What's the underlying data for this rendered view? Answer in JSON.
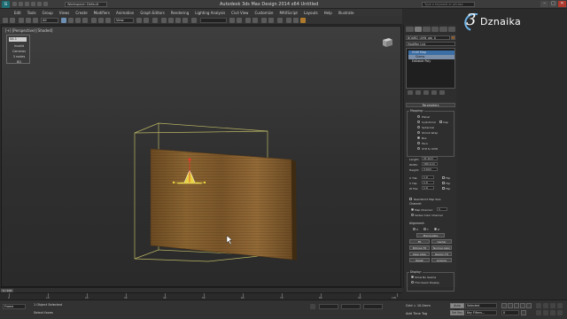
{
  "window": {
    "title": "Autodesk 3ds Max Design 2014 x64     Untitled",
    "workspace": "Workspace: Default",
    "search_placeholder": "Type a keyword or phrase",
    "minimize": "–",
    "maximize": "□",
    "close": "✕"
  },
  "brand": {
    "mark": "3",
    "name": "Dznaika"
  },
  "menu": [
    "Edit",
    "Tools",
    "Group",
    "Views",
    "Create",
    "Modifiers",
    "Animation",
    "Graph Editors",
    "Rendering",
    "Lighting Analysis",
    "Civil View",
    "Customize",
    "MAXScript",
    "Layouts",
    "Help",
    "Illustrate"
  ],
  "toolbar": {
    "selection_filter": "All",
    "view_dropdown": "View"
  },
  "viewport": {
    "label": "[+] [Perspective] [Shaded]",
    "stats": {
      "head": "SA 1",
      "rows": [
        "Invalid",
        "Cameras",
        "3 nodes",
        "BD"
      ]
    }
  },
  "command_panel": {
    "object_name": "BOARD_UVW_obj_0",
    "modifier_list": "Modifier List",
    "stack": [
      {
        "label": "UVW Map",
        "kind": "sel"
      },
      {
        "label": "Gizmo",
        "kind": "sub"
      },
      {
        "label": "Editable Poly",
        "kind": "normal"
      }
    ],
    "parameters_title": "Parameters",
    "mapping_title": "Mapping:",
    "mapping_options": [
      "Planar",
      "Cylindrical",
      "Spherical",
      "Shrink Wrap",
      "Box",
      "Face",
      "XYZ to UVW"
    ],
    "cap_label": "Cap",
    "selected_mapping": "Box",
    "length_label": "Length:",
    "length_value": "21.0cm",
    "width_label": "Width:",
    "width_value": "180.1cm",
    "height_label": "Height:",
    "height_value": "3.0cm",
    "utile_label": "U Tile:",
    "utile_value": "1.0",
    "vtile_label": "V Tile:",
    "vtile_value": "1.0",
    "wtile_label": "W Tile:",
    "wtile_value": "1.0",
    "flip_label": "Flip",
    "real_world": "Real-World Map Size",
    "channel_title": "Channel:",
    "map_channel_label": "Map Channel:",
    "map_channel_value": "1",
    "vertex_color": "Vertex Color Channel",
    "alignment_title": "Alignment:",
    "axes": [
      "X",
      "Y",
      "Z"
    ],
    "manipulate": "Manipulate",
    "buttons": [
      "Fit",
      "Center",
      "Bitmap Fit",
      "Normal Align",
      "View Align",
      "Region Fit",
      "Reset",
      "Acquire"
    ],
    "display_title": "Display:",
    "display_options": [
      "Show No Seams",
      "Thin Seam Display",
      "Thick Seam Display"
    ]
  },
  "timeline": {
    "slider": "0 / 100",
    "ticks": [
      "0",
      "10",
      "20",
      "30",
      "40",
      "50",
      "60",
      "70",
      "80",
      "90",
      "100"
    ]
  },
  "status": {
    "selection": "1 Object Selected",
    "prompt": "Select faces",
    "frame_field": "Frame",
    "grid": "Grid = 10.0mm",
    "auto_key": "Auto Key",
    "set_key": "Set Key",
    "selected": "Selected",
    "key_filters": "Key Filters...",
    "add_time_tag": "Add Time Tag",
    "frame_value": "0"
  }
}
